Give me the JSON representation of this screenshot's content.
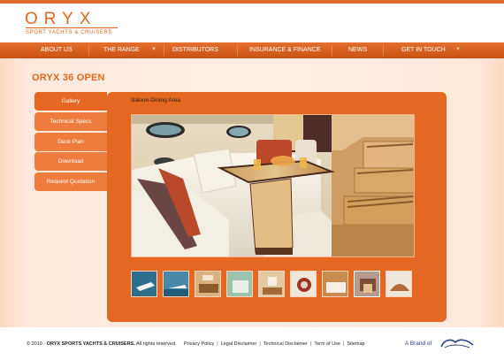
{
  "logo": {
    "wordmark": "ORYX",
    "tagline": "SPORT YACHTS & CRUISERS"
  },
  "nav": {
    "items": [
      {
        "label": "ABOUT US",
        "dropdown": false
      },
      {
        "label": "THE RANGE",
        "dropdown": true
      },
      {
        "label": "DISTRIBUTORS",
        "dropdown": false
      },
      {
        "label": "INSURANCE & FINANCE",
        "dropdown": false
      },
      {
        "label": "NEWS",
        "dropdown": false
      },
      {
        "label": "GET IN TOUCH",
        "dropdown": true
      }
    ]
  },
  "page": {
    "title": "ORYX 36 OPEN"
  },
  "sidebar": {
    "tabs": [
      {
        "label": "Gallery",
        "active": true
      },
      {
        "label": "Technical Specs",
        "active": false
      },
      {
        "label": "Deck Plan",
        "active": false
      },
      {
        "label": "Download",
        "active": false
      },
      {
        "label": "Request Quotation",
        "active": false
      }
    ]
  },
  "gallery": {
    "caption": "Saloon-Dining Area",
    "thumbnails": [
      {
        "icon": "thumb-yacht-aerial"
      },
      {
        "icon": "thumb-yacht-cruising"
      },
      {
        "icon": "thumb-galley"
      },
      {
        "icon": "thumb-interior-cabin"
      },
      {
        "icon": "thumb-cockpit"
      },
      {
        "icon": "thumb-helm"
      },
      {
        "icon": "thumb-bedroom"
      },
      {
        "icon": "thumb-saloon-selected"
      },
      {
        "icon": "thumb-deck-seating"
      }
    ]
  },
  "footer": {
    "copyright_prefix": "© 2010 - ",
    "copyright_company": "ORYX SPORTS YACHTS & CRUISERS.",
    "copyright_suffix": " All rights reserved.",
    "links": [
      "Privacy Policy",
      "Legal Disclaimer",
      "Technical Disclaimer",
      "Term of Use",
      "Sitemap"
    ],
    "brand_prefix": "A Brand of",
    "brand_logo": "Gulf Craft"
  },
  "colors": {
    "accent": "#e5671f",
    "panel": "#e46722",
    "tab_inactive": "#ed7c3e",
    "content_bg": "#fdeee4"
  }
}
